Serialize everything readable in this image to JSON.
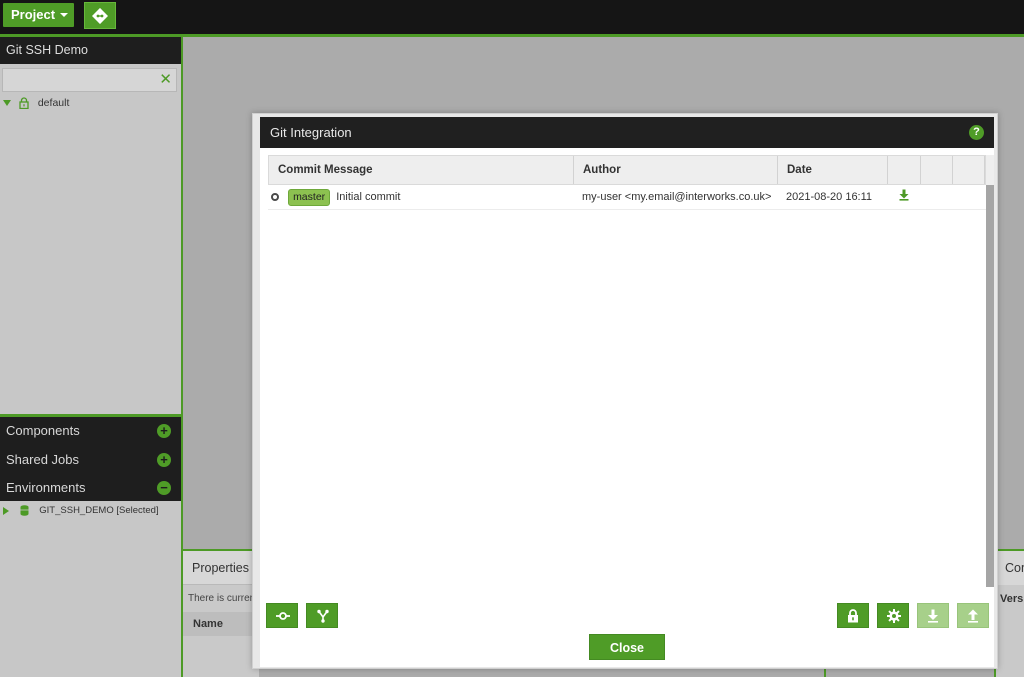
{
  "topbar": {
    "project_label": "Project",
    "git_button_icon": "git-icon"
  },
  "sidebar": {
    "title": "Git SSH Demo",
    "search": {
      "value": "",
      "placeholder": ""
    },
    "tree": [
      {
        "label": "default",
        "icon": "lock-icon"
      }
    ],
    "sections": [
      {
        "label": "Components",
        "action": "+"
      },
      {
        "label": "Shared Jobs",
        "action": "+"
      },
      {
        "label": "Environments",
        "action": "−"
      }
    ],
    "environment_item": "GIT_SSH_DEMO [Selected]"
  },
  "bottom_panels": {
    "properties_tab": "Properties",
    "properties_info": "There is current",
    "name_header": "Name",
    "right_tab": "Com",
    "right_header": "Versi"
  },
  "dialog": {
    "title": "Git Integration",
    "help_icon": "?",
    "columns": [
      "Commit Message",
      "Author",
      "Date",
      "",
      "",
      ""
    ],
    "commits": [
      {
        "branch": "master",
        "message": "Initial commit",
        "author": "my-user <my.email@interworks.co.uk>",
        "date": "2021-08-20 16:11",
        "action_icon": "download-icon"
      }
    ],
    "left_buttons": [
      "commit-icon",
      "branch-icon"
    ],
    "right_buttons": [
      "lock-icon",
      "gear-icon",
      "download-icon",
      "upload-icon"
    ],
    "close_label": "Close"
  },
  "colors": {
    "accent": "#4f9c27",
    "dark": "#1e1e1e",
    "badge": "#8cc150"
  }
}
